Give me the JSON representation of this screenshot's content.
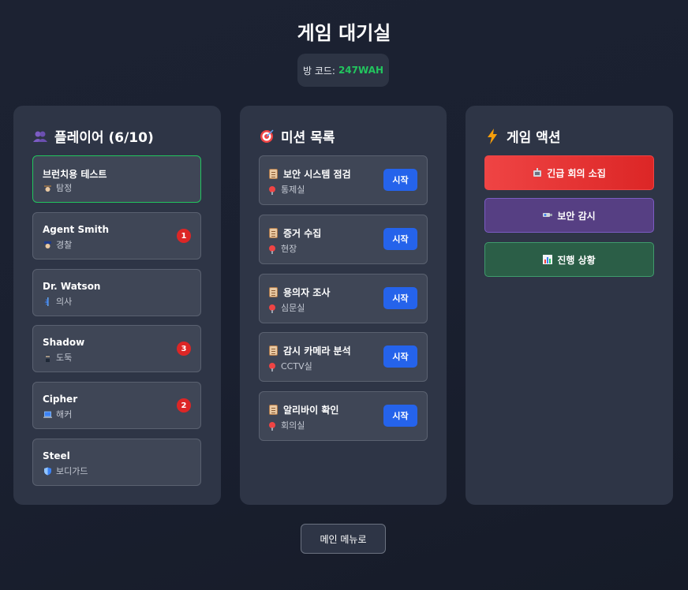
{
  "title": "게임 대기실",
  "room": {
    "label": "방 코드:",
    "code": "247WAH"
  },
  "players": {
    "header": "플레이어 (6/10)",
    "icon": "people-icon",
    "items": [
      {
        "name": "브런치용 테스트",
        "role": "탐정",
        "role_icon": "detective-icon",
        "badge": ""
      },
      {
        "name": "Agent Smith",
        "role": "경찰",
        "role_icon": "police-icon",
        "badge": "1"
      },
      {
        "name": "Dr. Watson",
        "role": "의사",
        "role_icon": "caduceus-icon",
        "badge": ""
      },
      {
        "name": "Shadow",
        "role": "도둑",
        "role_icon": "ninja-icon",
        "badge": "3"
      },
      {
        "name": "Cipher",
        "role": "해커",
        "role_icon": "laptop-icon",
        "badge": "2"
      },
      {
        "name": "Steel",
        "role": "보디가드",
        "role_icon": "shield-icon",
        "badge": ""
      }
    ]
  },
  "missions": {
    "header": "미션 목록",
    "icon": "target-icon",
    "start_label": "시작",
    "items": [
      {
        "title": "보안 시스템 점검",
        "location": "통제실"
      },
      {
        "title": "증거 수집",
        "location": "현장"
      },
      {
        "title": "용의자 조사",
        "location": "심문실"
      },
      {
        "title": "감시 카메라 분석",
        "location": "CCTV실"
      },
      {
        "title": "알리바이 확인",
        "location": "회의실"
      }
    ]
  },
  "actions": {
    "header": "게임 액션",
    "icon": "lightning-icon",
    "emergency": "긴급 회의 소집",
    "security": "보안 감시",
    "progress": "진행 상황"
  },
  "main_menu": "메인 메뉴로",
  "colors": {
    "accent_green": "#22c55e",
    "badge_red": "#dc2626",
    "start_blue": "#2563eb",
    "emergency_red": "#ef4444",
    "security_purple": "#563f83",
    "progress_green": "#2b5e47"
  }
}
